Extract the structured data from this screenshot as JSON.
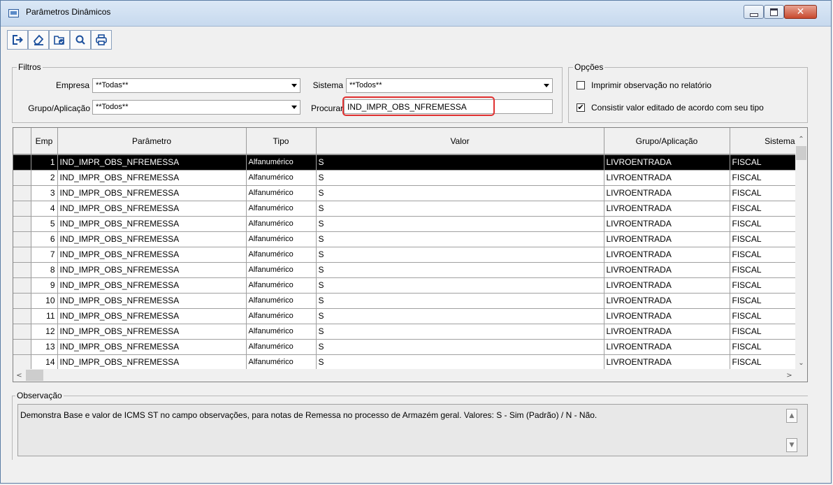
{
  "window": {
    "title": "Parâmetros Dinâmicos",
    "minimize_icon": "minimize-icon",
    "maximize_icon": "maximize-icon",
    "close_glyph": "✕"
  },
  "toolbar": {
    "buttons": [
      {
        "name": "exit-icon",
        "tooltip": "Sair"
      },
      {
        "name": "eraser-icon",
        "tooltip": "Limpar"
      },
      {
        "name": "confirm-folder-icon",
        "tooltip": "Confirmar"
      },
      {
        "name": "search-icon",
        "tooltip": "Pesquisar"
      },
      {
        "name": "printer-icon",
        "tooltip": "Imprimir"
      }
    ]
  },
  "filters": {
    "group_label": "Filtros",
    "empresa_label": "Empresa",
    "empresa_value": "**Todas**",
    "sistema_label": "Sistema",
    "sistema_value": "**Todos**",
    "grupo_label": "Grupo/Aplicação",
    "grupo_value": "**Todos**",
    "procurar_label": "Procurar",
    "procurar_value": "IND_IMPR_OBS_NFREMESSA"
  },
  "options": {
    "group_label": "Opções",
    "opt1_label": "Imprimir observação no relatório",
    "opt1_checked": false,
    "opt2_label": "Consistir valor editado de acordo com seu tipo",
    "opt2_checked": true,
    "check_glyph": "✔"
  },
  "grid": {
    "headers": {
      "emp": "Emp",
      "parametro": "Parâmetro",
      "tipo": "Tipo",
      "valor": "Valor",
      "grupo": "Grupo/Aplicação",
      "sistema": "Sistema"
    },
    "selected_row": 0,
    "rows": [
      {
        "emp": "1",
        "parametro": "IND_IMPR_OBS_NFREMESSA",
        "tipo": "Alfanumérico",
        "valor": "S",
        "grupo": "LIVROENTRADA",
        "sistema": "FISCAL"
      },
      {
        "emp": "2",
        "parametro": "IND_IMPR_OBS_NFREMESSA",
        "tipo": "Alfanumérico",
        "valor": "S",
        "grupo": "LIVROENTRADA",
        "sistema": "FISCAL"
      },
      {
        "emp": "3",
        "parametro": "IND_IMPR_OBS_NFREMESSA",
        "tipo": "Alfanumérico",
        "valor": "S",
        "grupo": "LIVROENTRADA",
        "sistema": "FISCAL"
      },
      {
        "emp": "4",
        "parametro": "IND_IMPR_OBS_NFREMESSA",
        "tipo": "Alfanumérico",
        "valor": "S",
        "grupo": "LIVROENTRADA",
        "sistema": "FISCAL"
      },
      {
        "emp": "5",
        "parametro": "IND_IMPR_OBS_NFREMESSA",
        "tipo": "Alfanumérico",
        "valor": "S",
        "grupo": "LIVROENTRADA",
        "sistema": "FISCAL"
      },
      {
        "emp": "6",
        "parametro": "IND_IMPR_OBS_NFREMESSA",
        "tipo": "Alfanumérico",
        "valor": "S",
        "grupo": "LIVROENTRADA",
        "sistema": "FISCAL"
      },
      {
        "emp": "7",
        "parametro": "IND_IMPR_OBS_NFREMESSA",
        "tipo": "Alfanumérico",
        "valor": "S",
        "grupo": "LIVROENTRADA",
        "sistema": "FISCAL"
      },
      {
        "emp": "8",
        "parametro": "IND_IMPR_OBS_NFREMESSA",
        "tipo": "Alfanumérico",
        "valor": "S",
        "grupo": "LIVROENTRADA",
        "sistema": "FISCAL"
      },
      {
        "emp": "9",
        "parametro": "IND_IMPR_OBS_NFREMESSA",
        "tipo": "Alfanumérico",
        "valor": "S",
        "grupo": "LIVROENTRADA",
        "sistema": "FISCAL"
      },
      {
        "emp": "10",
        "parametro": "IND_IMPR_OBS_NFREMESSA",
        "tipo": "Alfanumérico",
        "valor": "S",
        "grupo": "LIVROENTRADA",
        "sistema": "FISCAL"
      },
      {
        "emp": "11",
        "parametro": "IND_IMPR_OBS_NFREMESSA",
        "tipo": "Alfanumérico",
        "valor": "S",
        "grupo": "LIVROENTRADA",
        "sistema": "FISCAL"
      },
      {
        "emp": "12",
        "parametro": "IND_IMPR_OBS_NFREMESSA",
        "tipo": "Alfanumérico",
        "valor": "S",
        "grupo": "LIVROENTRADA",
        "sistema": "FISCAL"
      },
      {
        "emp": "13",
        "parametro": "IND_IMPR_OBS_NFREMESSA",
        "tipo": "Alfanumérico",
        "valor": "S",
        "grupo": "LIVROENTRADA",
        "sistema": "FISCAL"
      },
      {
        "emp": "14",
        "parametro": "IND_IMPR_OBS_NFREMESSA",
        "tipo": "Alfanumérico",
        "valor": "S",
        "grupo": "LIVROENTRADA",
        "sistema": "FISCAL"
      }
    ],
    "scroll_up": "⌃",
    "scroll_down": "⌄",
    "scroll_left": "<",
    "scroll_right": ">"
  },
  "observacao": {
    "group_label": "Observação",
    "text": "Demonstra Base e valor de ICMS ST no campo observações, para notas de Remessa no processo de Armazém geral. Valores: S - Sim (Padrão) / N - Não.",
    "scroll_up": "▲",
    "scroll_down": "▼"
  },
  "colors": {
    "highlight_border": "#e03030",
    "selected_row_bg": "#000000",
    "close_button": "#c84a2e",
    "toolbar_icon": "#1b4f9c"
  }
}
